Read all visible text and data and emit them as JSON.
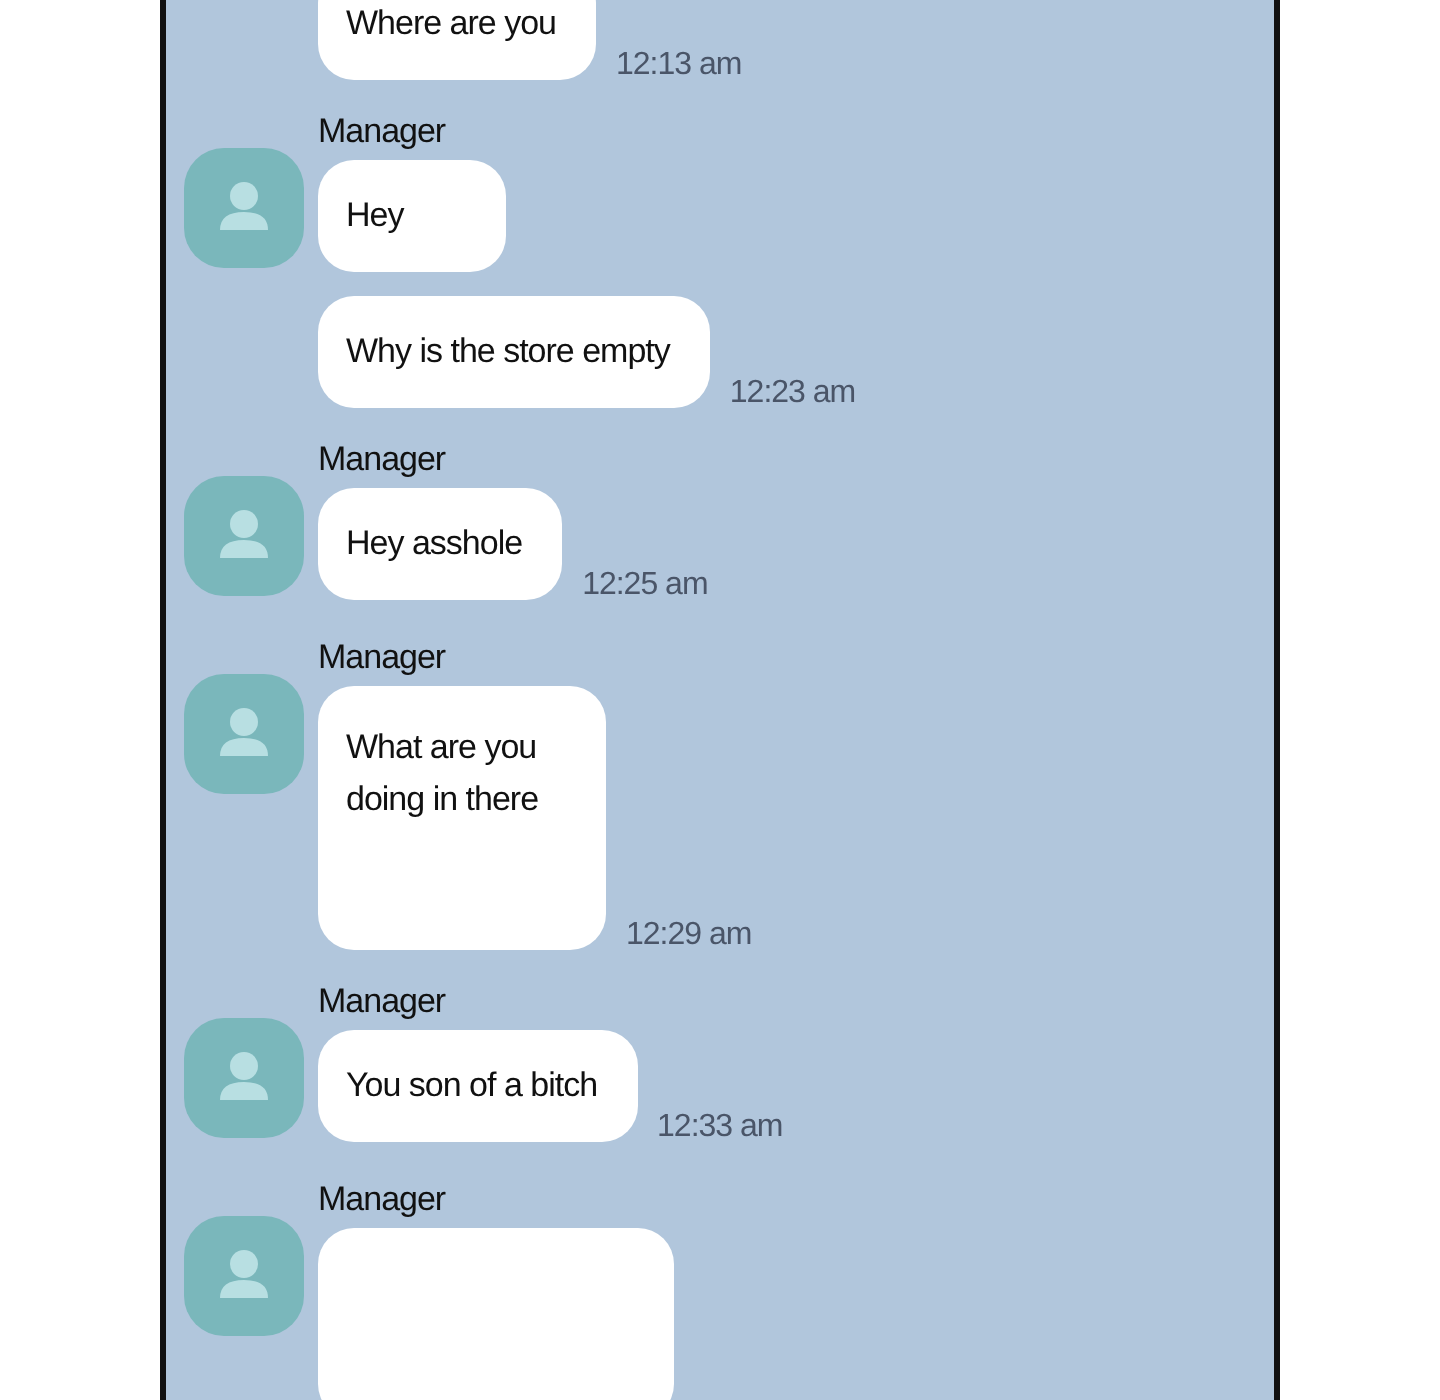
{
  "groups": [
    {
      "messages": [
        {
          "kind": "text",
          "text": "Where are you",
          "time": "12:13 am"
        }
      ]
    },
    {
      "sender": "Manager",
      "messages": [
        {
          "kind": "text",
          "text": "Hey"
        },
        {
          "kind": "text",
          "text": "Why is the store empty",
          "time": "12:23 am"
        }
      ]
    },
    {
      "sender": "Manager",
      "messages": [
        {
          "kind": "text",
          "text": "Hey asshole",
          "time": "12:25 am"
        }
      ]
    },
    {
      "sender": "Manager",
      "messages": [
        {
          "kind": "tall",
          "text": "What are you doing in there",
          "time": "12:29 am"
        }
      ]
    },
    {
      "sender": "Manager",
      "messages": [
        {
          "kind": "text",
          "text": "You son of a bitch",
          "time": "12:33 am"
        }
      ]
    },
    {
      "sender": "Manager",
      "messages": [
        {
          "kind": "cut"
        }
      ]
    }
  ]
}
